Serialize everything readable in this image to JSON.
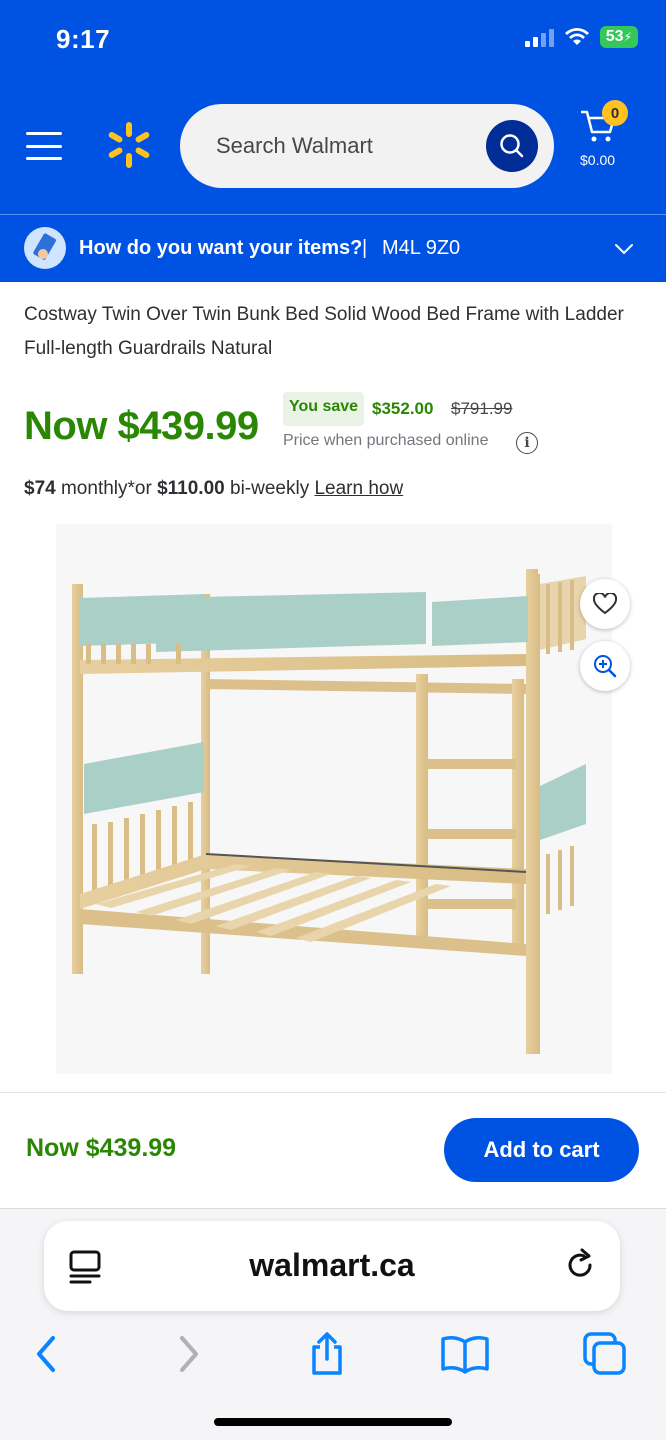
{
  "status_bar": {
    "time": "9:17",
    "battery": "53"
  },
  "header": {
    "search_placeholder": "Search Walmart",
    "cart_count": "0",
    "cart_total": "$0.00"
  },
  "delivery": {
    "question": "How do you want your items?",
    "separator": "|",
    "postal_code": "M4L 9Z0"
  },
  "product": {
    "title": "Costway Twin Over Twin Bunk Bed Solid Wood Bed Frame with Ladder Full-length Guardrails Natural",
    "price_now": "Now $439.99",
    "you_save_label": "You save",
    "save_amount": "$352.00",
    "was_price": "$791.99",
    "price_note": "Price when purchased online",
    "financing": {
      "monthly_amount": "$74",
      "monthly_text": " monthly*or ",
      "biweekly_amount": "$110.00",
      "biweekly_text": " bi-weekly ",
      "learn_how": "Learn how"
    }
  },
  "sticky_bar": {
    "price": "Now $439.99",
    "add_to_cart": "Add to cart"
  },
  "browser": {
    "url": "walmart.ca"
  },
  "colors": {
    "brand_blue": "#0053e2",
    "spark_yellow": "#ffc220",
    "price_green": "#2a8703"
  }
}
